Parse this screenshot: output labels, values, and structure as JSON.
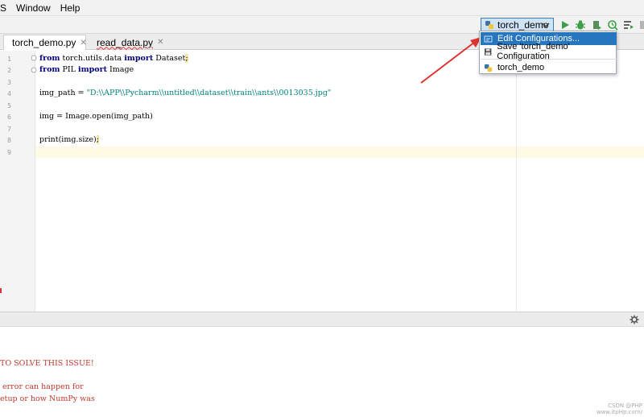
{
  "menu": {
    "items": [
      {
        "label": "S"
      },
      {
        "label": "Window"
      },
      {
        "label": "Help"
      }
    ]
  },
  "toolbar": {
    "run_config_label": "torch_demo"
  },
  "tabs": [
    {
      "label": "torch_demo.py",
      "active": true
    },
    {
      "label": "read_data.py",
      "active": false
    }
  ],
  "editor": {
    "line_numbers": [
      "1",
      "2",
      "3",
      "4",
      "5",
      "6",
      "7",
      "8",
      "9"
    ],
    "code": {
      "line1_kw_from": "from",
      "line1_mod": " torch.utils.data ",
      "line1_kw_import": "import",
      "line1_name": " Dataset",
      "line1_semi": ";",
      "line2_kw_from": "from",
      "line2_mod": " PIL ",
      "line2_kw_import": "import",
      "line2_name": " Image",
      "line4_prefix": "img_path = ",
      "line4_string": "\"D:\\\\APP\\\\Pycharm\\\\untitled\\\\dataset\\\\train\\\\ants\\\\0013035.jpg\"",
      "line6": "img = Image.open(img_path)",
      "line8_main": "print(img.size)",
      "line8_semi": ";"
    }
  },
  "popup": {
    "items": [
      {
        "label": "Edit Configurations..."
      },
      {
        "label": "Save 'torch_demo' Configuration"
      },
      {
        "label": "torch_demo"
      }
    ]
  },
  "console": {
    "lines": [
      "TO SOLVE THIS ISSUE!",
      " error can happen for",
      "etup or how NumPy was"
    ]
  },
  "watermark": {
    "line1": "CSDN @PHP",
    "line2": "www.itpHp.com/"
  },
  "colors": {
    "accent_blue": "#2675bf",
    "run_green": "#3da048",
    "error_red": "#c0392b",
    "arrow_red": "#e03131"
  }
}
